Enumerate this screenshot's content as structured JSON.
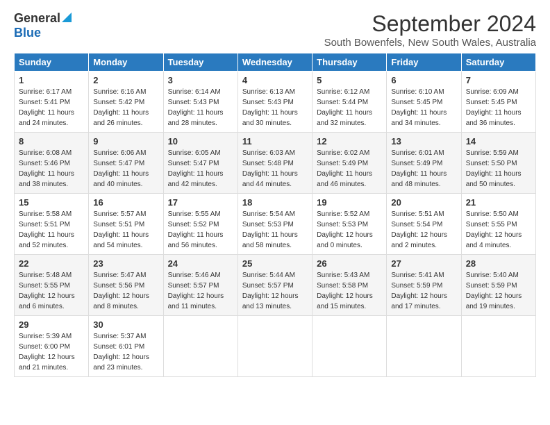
{
  "header": {
    "logo_general": "General",
    "logo_blue": "Blue",
    "month_title": "September 2024",
    "subtitle": "South Bowenfels, New South Wales, Australia"
  },
  "days_of_week": [
    "Sunday",
    "Monday",
    "Tuesday",
    "Wednesday",
    "Thursday",
    "Friday",
    "Saturday"
  ],
  "weeks": [
    [
      {
        "day": "1",
        "sunrise": "6:17 AM",
        "sunset": "5:41 PM",
        "daylight": "11 hours and 24 minutes."
      },
      {
        "day": "2",
        "sunrise": "6:16 AM",
        "sunset": "5:42 PM",
        "daylight": "11 hours and 26 minutes."
      },
      {
        "day": "3",
        "sunrise": "6:14 AM",
        "sunset": "5:43 PM",
        "daylight": "11 hours and 28 minutes."
      },
      {
        "day": "4",
        "sunrise": "6:13 AM",
        "sunset": "5:43 PM",
        "daylight": "11 hours and 30 minutes."
      },
      {
        "day": "5",
        "sunrise": "6:12 AM",
        "sunset": "5:44 PM",
        "daylight": "11 hours and 32 minutes."
      },
      {
        "day": "6",
        "sunrise": "6:10 AM",
        "sunset": "5:45 PM",
        "daylight": "11 hours and 34 minutes."
      },
      {
        "day": "7",
        "sunrise": "6:09 AM",
        "sunset": "5:45 PM",
        "daylight": "11 hours and 36 minutes."
      }
    ],
    [
      {
        "day": "8",
        "sunrise": "6:08 AM",
        "sunset": "5:46 PM",
        "daylight": "11 hours and 38 minutes."
      },
      {
        "day": "9",
        "sunrise": "6:06 AM",
        "sunset": "5:47 PM",
        "daylight": "11 hours and 40 minutes."
      },
      {
        "day": "10",
        "sunrise": "6:05 AM",
        "sunset": "5:47 PM",
        "daylight": "11 hours and 42 minutes."
      },
      {
        "day": "11",
        "sunrise": "6:03 AM",
        "sunset": "5:48 PM",
        "daylight": "11 hours and 44 minutes."
      },
      {
        "day": "12",
        "sunrise": "6:02 AM",
        "sunset": "5:49 PM",
        "daylight": "11 hours and 46 minutes."
      },
      {
        "day": "13",
        "sunrise": "6:01 AM",
        "sunset": "5:49 PM",
        "daylight": "11 hours and 48 minutes."
      },
      {
        "day": "14",
        "sunrise": "5:59 AM",
        "sunset": "5:50 PM",
        "daylight": "11 hours and 50 minutes."
      }
    ],
    [
      {
        "day": "15",
        "sunrise": "5:58 AM",
        "sunset": "5:51 PM",
        "daylight": "11 hours and 52 minutes."
      },
      {
        "day": "16",
        "sunrise": "5:57 AM",
        "sunset": "5:51 PM",
        "daylight": "11 hours and 54 minutes."
      },
      {
        "day": "17",
        "sunrise": "5:55 AM",
        "sunset": "5:52 PM",
        "daylight": "11 hours and 56 minutes."
      },
      {
        "day": "18",
        "sunrise": "5:54 AM",
        "sunset": "5:53 PM",
        "daylight": "11 hours and 58 minutes."
      },
      {
        "day": "19",
        "sunrise": "5:52 AM",
        "sunset": "5:53 PM",
        "daylight": "12 hours and 0 minutes."
      },
      {
        "day": "20",
        "sunrise": "5:51 AM",
        "sunset": "5:54 PM",
        "daylight": "12 hours and 2 minutes."
      },
      {
        "day": "21",
        "sunrise": "5:50 AM",
        "sunset": "5:55 PM",
        "daylight": "12 hours and 4 minutes."
      }
    ],
    [
      {
        "day": "22",
        "sunrise": "5:48 AM",
        "sunset": "5:55 PM",
        "daylight": "12 hours and 6 minutes."
      },
      {
        "day": "23",
        "sunrise": "5:47 AM",
        "sunset": "5:56 PM",
        "daylight": "12 hours and 8 minutes."
      },
      {
        "day": "24",
        "sunrise": "5:46 AM",
        "sunset": "5:57 PM",
        "daylight": "12 hours and 11 minutes."
      },
      {
        "day": "25",
        "sunrise": "5:44 AM",
        "sunset": "5:57 PM",
        "daylight": "12 hours and 13 minutes."
      },
      {
        "day": "26",
        "sunrise": "5:43 AM",
        "sunset": "5:58 PM",
        "daylight": "12 hours and 15 minutes."
      },
      {
        "day": "27",
        "sunrise": "5:41 AM",
        "sunset": "5:59 PM",
        "daylight": "12 hours and 17 minutes."
      },
      {
        "day": "28",
        "sunrise": "5:40 AM",
        "sunset": "5:59 PM",
        "daylight": "12 hours and 19 minutes."
      }
    ],
    [
      {
        "day": "29",
        "sunrise": "5:39 AM",
        "sunset": "6:00 PM",
        "daylight": "12 hours and 21 minutes."
      },
      {
        "day": "30",
        "sunrise": "5:37 AM",
        "sunset": "6:01 PM",
        "daylight": "12 hours and 23 minutes."
      },
      null,
      null,
      null,
      null,
      null
    ]
  ],
  "labels": {
    "sunrise": "Sunrise:",
    "sunset": "Sunset:",
    "daylight": "Daylight:"
  }
}
